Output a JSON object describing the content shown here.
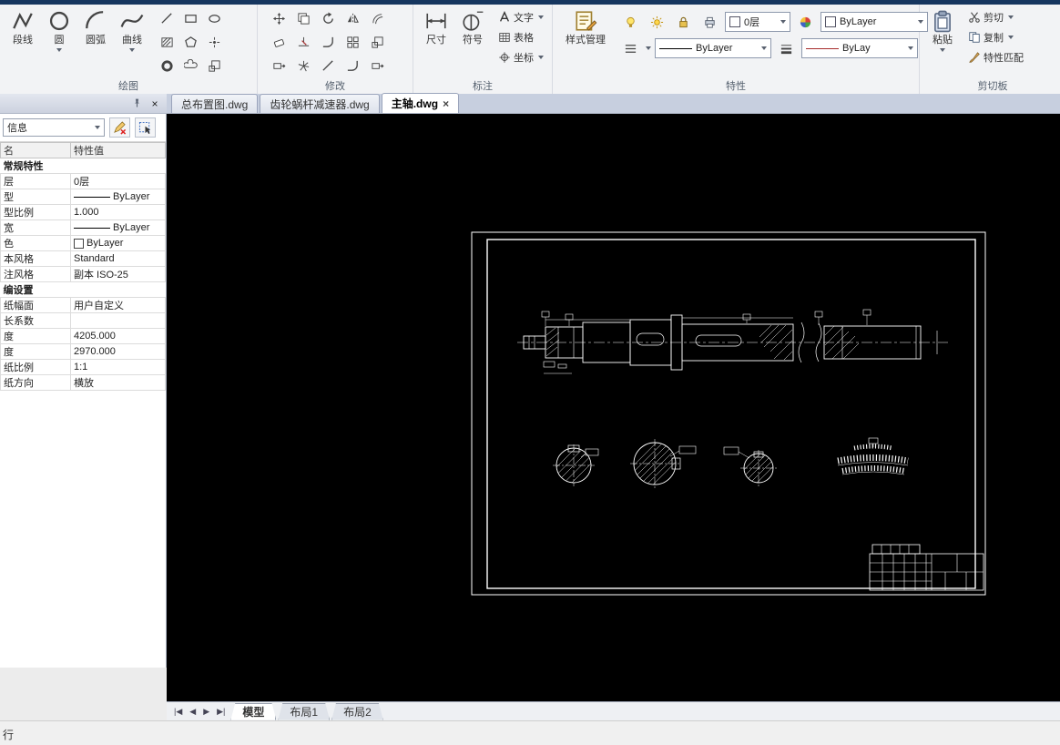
{
  "glyphs": {
    "close": "×",
    "nav": [
      "|◀",
      "◀",
      "▶",
      "▶|"
    ]
  },
  "ribbon": {
    "group_labels": [
      "绘图",
      "修改",
      "标注",
      "特性",
      "剪切板"
    ],
    "draw": {
      "polyline": "段线",
      "circle": "圆",
      "arc": "圆弧",
      "spline": "曲线"
    },
    "annotate": {
      "dimension": "尺寸",
      "symbol": "符号",
      "text": "文字",
      "table": "表格",
      "coordinate": "坐标"
    },
    "properties": {
      "style_manager": "样式管理",
      "layer_value": "0层",
      "color_value": "ByLayer",
      "linetype_value": "ByLayer",
      "lineweight_value": "ByLay"
    },
    "clipboard": {
      "paste": "粘贴",
      "cut": "剪切",
      "copy": "复制",
      "match_properties": "特性匹配"
    }
  },
  "doc_tabs": [
    {
      "label": "总布置图.dwg"
    },
    {
      "label": "齿轮蜗杆减速器.dwg"
    },
    {
      "label": "主轴.dwg"
    }
  ],
  "panel": {
    "selector_value": "信息",
    "columns": [
      "名",
      "特性值"
    ],
    "rows": [
      {
        "label": "常规特性",
        "value": ""
      },
      {
        "label": "层",
        "value": "0层"
      },
      {
        "label": "型",
        "value": "ByLayer"
      },
      {
        "label": "型比例",
        "value": "1.000"
      },
      {
        "label": "宽",
        "value": "ByLayer"
      },
      {
        "label": "色",
        "value": "ByLayer"
      },
      {
        "label": "本风格",
        "value": "Standard"
      },
      {
        "label": "注风格",
        "value": "副本 ISO-25"
      },
      {
        "label": "编设置",
        "value": ""
      },
      {
        "label": "纸幅面",
        "value": "用户自定义"
      },
      {
        "label": "长系数",
        "value": ""
      },
      {
        "label": "度",
        "value": "4205.000"
      },
      {
        "label": "度",
        "value": "2970.000"
      },
      {
        "label": "纸比例",
        "value": "1:1"
      },
      {
        "label": "纸方向",
        "value": "横放"
      }
    ]
  },
  "layout_tabs": [
    {
      "label": "模型"
    },
    {
      "label": "布局1"
    },
    {
      "label": "布局2"
    }
  ],
  "statusbar": {
    "left": "行"
  }
}
